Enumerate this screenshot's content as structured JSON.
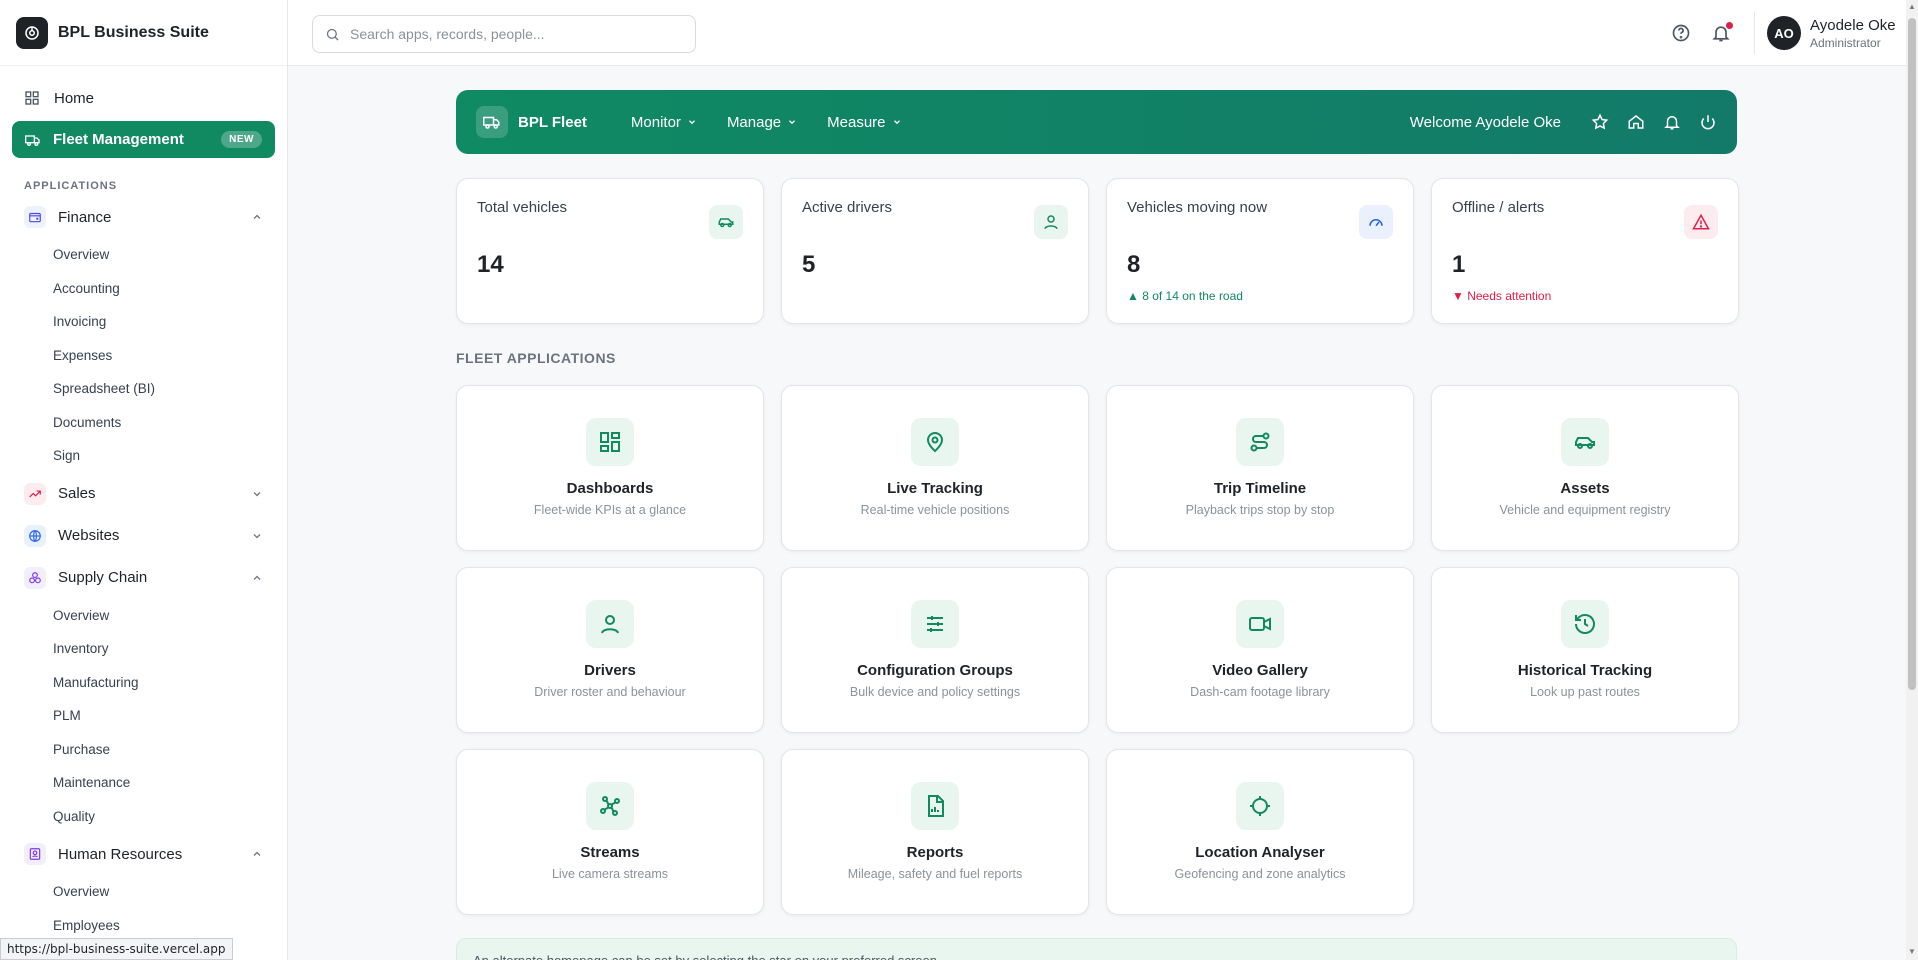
{
  "brand": {
    "name": "BPL Business Suite"
  },
  "sidebar": {
    "home": "Home",
    "fleet": {
      "label": "Fleet Management",
      "badge": "NEW"
    },
    "section_label": "APPLICATIONS",
    "finance": {
      "label": "Finance",
      "items": [
        "Overview",
        "Accounting",
        "Invoicing",
        "Expenses",
        "Spreadsheet (BI)",
        "Documents",
        "Sign"
      ]
    },
    "sales": {
      "label": "Sales"
    },
    "websites": {
      "label": "Websites"
    },
    "supply_chain": {
      "label": "Supply Chain",
      "items": [
        "Overview",
        "Inventory",
        "Manufacturing",
        "PLM",
        "Purchase",
        "Maintenance",
        "Quality"
      ]
    },
    "hr": {
      "label": "Human Resources",
      "items": [
        "Overview",
        "Employees"
      ]
    }
  },
  "status_url": "https://bpl-business-suite.vercel.app",
  "search": {
    "placeholder": "Search apps, records, people..."
  },
  "user": {
    "initials": "AO",
    "name": "Ayodele Oke",
    "role": "Administrator"
  },
  "fleet_header": {
    "title": "BPL Fleet",
    "menus": [
      "Monitor",
      "Manage",
      "Measure"
    ],
    "welcome": "Welcome Ayodele Oke"
  },
  "stats": [
    {
      "label": "Total vehicles",
      "value": "14",
      "note": "",
      "icon": "car-icon"
    },
    {
      "label": "Active drivers",
      "value": "5",
      "note": "",
      "icon": "user-icon"
    },
    {
      "label": "Vehicles moving now",
      "value": "8",
      "note": "▲ 8 of 14 on the road",
      "icon": "gauge-icon"
    },
    {
      "label": "Offline / alerts",
      "value": "1",
      "note": "▼ Needs attention",
      "icon": "alert-triangle-icon"
    }
  ],
  "apps_label": "FLEET APPLICATIONS",
  "apps": [
    {
      "title": "Dashboards",
      "desc": "Fleet-wide KPIs at a glance",
      "icon": "dashboard-icon"
    },
    {
      "title": "Live Tracking",
      "desc": "Real-time vehicle positions",
      "icon": "map-pin-icon"
    },
    {
      "title": "Trip Timeline",
      "desc": "Playback trips stop by stop",
      "icon": "route-icon"
    },
    {
      "title": "Assets",
      "desc": "Vehicle and equipment registry",
      "icon": "car-icon"
    },
    {
      "title": "Drivers",
      "desc": "Driver roster and behaviour",
      "icon": "user-icon"
    },
    {
      "title": "Configuration Groups",
      "desc": "Bulk device and policy settings",
      "icon": "sliders-icon"
    },
    {
      "title": "Video Gallery",
      "desc": "Dash-cam footage library",
      "icon": "video-icon"
    },
    {
      "title": "Historical Tracking",
      "desc": "Look up past routes",
      "icon": "history-icon"
    },
    {
      "title": "Streams",
      "desc": "Live camera streams",
      "icon": "share-icon"
    },
    {
      "title": "Reports",
      "desc": "Mileage, safety and fuel reports",
      "icon": "report-icon"
    },
    {
      "title": "Location Analyser",
      "desc": "Geofencing and zone analytics",
      "icon": "crosshair-icon"
    }
  ],
  "banner": "An alternate homepage can be set by selecting the star on your preferred screen.",
  "colors": {
    "brand_green": "#128a61",
    "alert_red": "#e11d48",
    "success_green": "#128a61"
  }
}
